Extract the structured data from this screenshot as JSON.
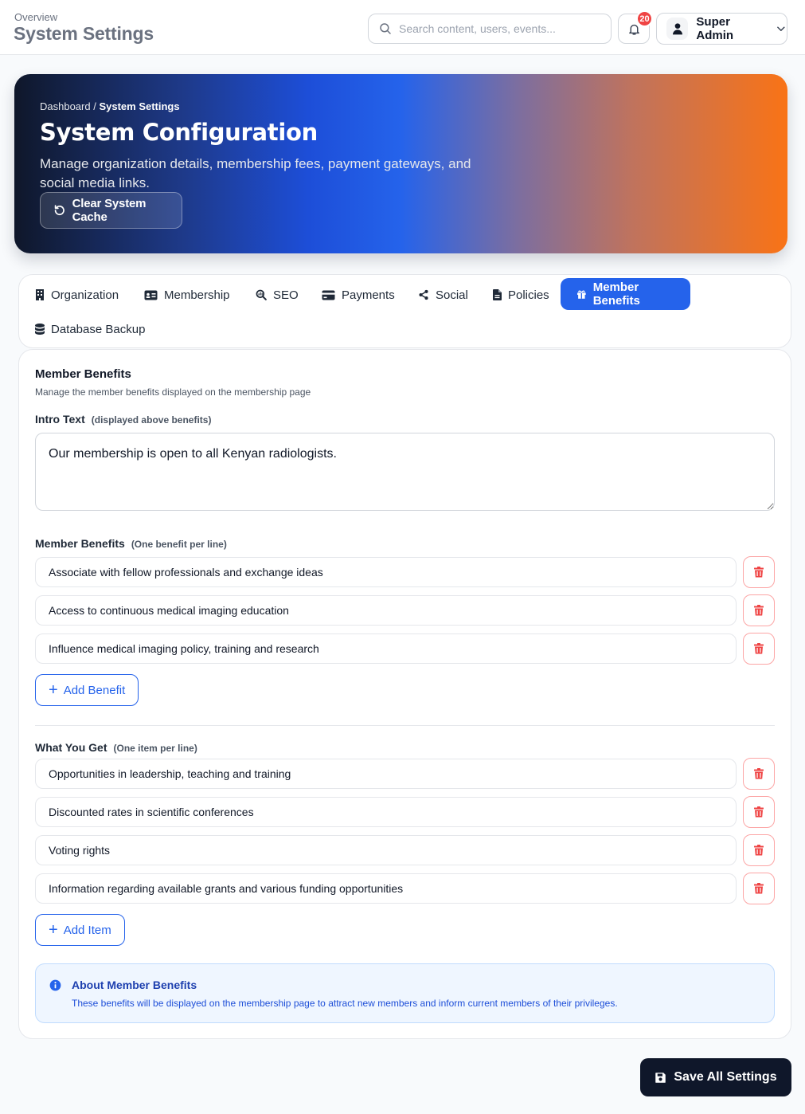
{
  "header": {
    "breadcrumb": "Overview",
    "title": "System Settings",
    "search_placeholder": "Search content, users, events...",
    "notification_count": "20",
    "user_name": "Super Admin"
  },
  "hero": {
    "crumb_parent": "Dashboard",
    "crumb_separator": " / ",
    "crumb_current": "System Settings",
    "title": "System Configuration",
    "description": "Manage organization details, membership fees, payment gateways, and social media links.",
    "cache_button": "Clear System Cache"
  },
  "tabs": [
    {
      "label": "Organization",
      "icon": "building-icon"
    },
    {
      "label": "Membership",
      "icon": "id-card-icon"
    },
    {
      "label": "SEO",
      "icon": "search-chart-icon"
    },
    {
      "label": "Payments",
      "icon": "credit-card-icon"
    },
    {
      "label": "Social",
      "icon": "share-icon"
    },
    {
      "label": "Policies",
      "icon": "document-icon"
    },
    {
      "label": "Member Benefits",
      "icon": "gift-icon",
      "active": true
    },
    {
      "label": "Database Backup",
      "icon": "database-icon"
    }
  ],
  "benefits_section": {
    "title": "Member Benefits",
    "subtitle": "Manage the member benefits displayed on the membership page",
    "intro_label": "Intro Text",
    "intro_hint": "(displayed above benefits)",
    "intro_value": "Our membership is open to all Kenyan radiologists.",
    "benefits_label": "Member Benefits",
    "benefits_hint": "(One benefit per line)",
    "benefits": [
      "Associate with fellow professionals and exchange ideas",
      "Access to continuous medical imaging education",
      "Influence medical imaging policy, training and research"
    ],
    "add_benefit_label": "Add Benefit",
    "what_label": "What You Get",
    "what_hint": "(One item per line)",
    "what_items": [
      "Opportunities in leadership, teaching and training",
      "Discounted rates in scientific conferences",
      "Voting rights",
      "Information regarding available grants and various funding opportunities"
    ],
    "add_item_label": "Add Item",
    "info_title": "About Member Benefits",
    "info_text": "These benefits will be displayed on the membership page to attract new members and inform current members of their privileges."
  },
  "save_button": "Save All Settings",
  "colors": {
    "accent": "#2563eb",
    "danger": "#ef4444",
    "dark": "#0f172a"
  }
}
